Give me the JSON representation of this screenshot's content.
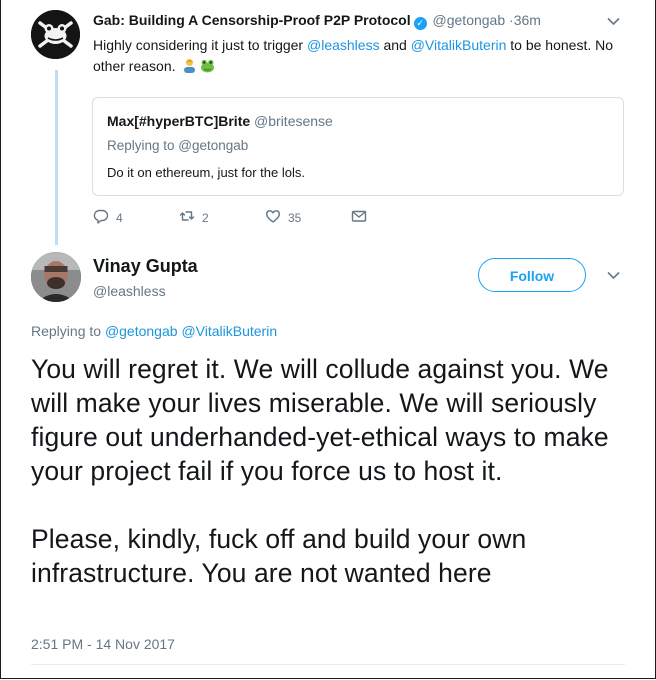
{
  "tweet1": {
    "display_name": "Gab: Building A Censorship-Proof P2P Protocol",
    "handle": "@getongab",
    "time": "36m",
    "text_before": "Highly considering it just to trigger ",
    "mention_1": "@leashless",
    "text_mid": " and ",
    "mention_2": "@VitalikButerin",
    "text_after": " to be honest. No other reason.",
    "emoji_1": "person-emoji",
    "emoji_2": "frog-emoji",
    "quoted": {
      "display_name": "Max[#hyperBTC]Brite",
      "handle": "@britesense",
      "replying_to": "Replying to @getongab",
      "text": "Do it on ethereum, just for the lols."
    },
    "actions": {
      "replies": "4",
      "retweets": "2",
      "likes": "35"
    }
  },
  "tweet2": {
    "display_name": "Vinay Gupta",
    "handle": "@leashless",
    "follow_label": "Follow",
    "replying_label": "Replying to ",
    "replying_mention_1": "@getongab",
    "replying_mention_2": "@VitalikButerin",
    "paragraph_1": "You will regret it. We will collude against you. We will make your lives miserable. We will seriously figure out underhanded-yet-ethical ways to make your project fail if you force us to host it.",
    "paragraph_2": "Please, kindly, fuck off and build your own infrastructure. You are not wanted here",
    "timestamp": "2:51 PM - 14 Nov 2017"
  },
  "colors": {
    "link": "#1b95e0",
    "follow": "#1da1f2",
    "muted": "#657786",
    "thread_line": "#c4dcef"
  },
  "icons": [
    "verified-badge-icon",
    "chevron-down-icon",
    "reply-icon",
    "retweet-icon",
    "like-icon",
    "direct-message-icon"
  ]
}
